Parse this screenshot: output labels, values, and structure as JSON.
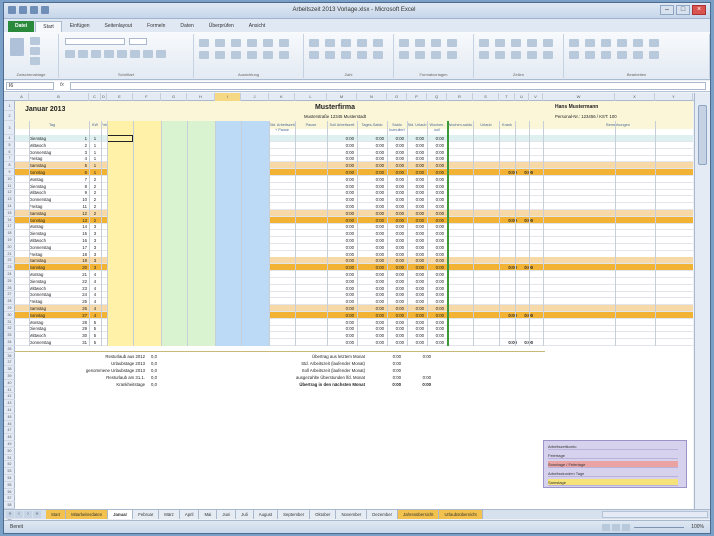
{
  "window": {
    "title": "Arbeitszeit 2013 Vorlage.xlsx - Microsoft Excel"
  },
  "ribbon_tabs": [
    "Datei",
    "Start",
    "Einfügen",
    "Seitenlayout",
    "Formeln",
    "Daten",
    "Überprüfen",
    "Ansicht"
  ],
  "ribbon_groups": [
    "Zwischenablage",
    "Schriftart",
    "Ausrichtung",
    "Zahl",
    "Formatvorlagen",
    "Zellen",
    "Bearbeiten"
  ],
  "formula_bar": {
    "name_box": "I6",
    "fx": "fx",
    "value": ""
  },
  "columns": [
    "A",
    "B",
    "C",
    "D",
    "E",
    "F",
    "G",
    "H",
    "I",
    "J",
    "K",
    "L",
    "M",
    "N",
    "O",
    "P",
    "Q",
    "R",
    "S",
    "T",
    "U",
    "V",
    "W",
    "X",
    "Y",
    "Z"
  ],
  "header": {
    "month": "Januar 2013",
    "company": "Musterfirma",
    "address": "Musterstraße 12345 Musterstadt",
    "employee": "Hans Mustermann",
    "personnel": "Personal-Nr.: 123456 / KST: 100"
  },
  "table_headers": [
    "Tag",
    "KW",
    "Feiertag",
    "Beginn 1",
    "Ende 1",
    "Beginn 2",
    "Ende 2",
    "Beginn 3",
    "Ende 3",
    "Std. Arbeitszeit + Pause",
    "Pause",
    "Soll Arbeitszeit",
    "Tages-Saldo",
    "Saldo kumuliert",
    "Std. Urlaub",
    "Wochen-soll",
    "Wochen-saldo",
    "Urlaub",
    "Krank",
    "Bemerkungen"
  ],
  "days": [
    {
      "n": "1",
      "name": "Dienstag",
      "kw": "1",
      "type": "holiday",
      "note": "Neujahr"
    },
    {
      "n": "2",
      "name": "Mittwoch",
      "kw": "1",
      "type": "normal"
    },
    {
      "n": "3",
      "name": "Donnerstag",
      "kw": "1",
      "type": "normal"
    },
    {
      "n": "4",
      "name": "Freitag",
      "kw": "1",
      "type": "normal"
    },
    {
      "n": "5",
      "name": "Samstag",
      "kw": "1",
      "type": "sat"
    },
    {
      "n": "6",
      "name": "Sonntag",
      "kw": "1",
      "type": "sunholiday",
      "note": "Hl. 3 Könige",
      "wk": true
    },
    {
      "n": "7",
      "name": "Montag",
      "kw": "2",
      "type": "normal"
    },
    {
      "n": "8",
      "name": "Dienstag",
      "kw": "2",
      "type": "normal"
    },
    {
      "n": "9",
      "name": "Mittwoch",
      "kw": "2",
      "type": "normal"
    },
    {
      "n": "10",
      "name": "Donnerstag",
      "kw": "2",
      "type": "normal"
    },
    {
      "n": "11",
      "name": "Freitag",
      "kw": "2",
      "type": "normal"
    },
    {
      "n": "12",
      "name": "Samstag",
      "kw": "2",
      "type": "sat"
    },
    {
      "n": "13",
      "name": "Sonntag",
      "kw": "2",
      "type": "sun",
      "wk": true
    },
    {
      "n": "14",
      "name": "Montag",
      "kw": "3",
      "type": "normal"
    },
    {
      "n": "15",
      "name": "Dienstag",
      "kw": "3",
      "type": "normal"
    },
    {
      "n": "16",
      "name": "Mittwoch",
      "kw": "3",
      "type": "normal"
    },
    {
      "n": "17",
      "name": "Donnerstag",
      "kw": "3",
      "type": "normal"
    },
    {
      "n": "18",
      "name": "Freitag",
      "kw": "3",
      "type": "normal"
    },
    {
      "n": "19",
      "name": "Samstag",
      "kw": "3",
      "type": "sat"
    },
    {
      "n": "20",
      "name": "Sonntag",
      "kw": "3",
      "type": "sun",
      "wk": true
    },
    {
      "n": "21",
      "name": "Montag",
      "kw": "4",
      "type": "normal"
    },
    {
      "n": "22",
      "name": "Dienstag",
      "kw": "4",
      "type": "normal"
    },
    {
      "n": "23",
      "name": "Mittwoch",
      "kw": "4",
      "type": "normal"
    },
    {
      "n": "24",
      "name": "Donnerstag",
      "kw": "4",
      "type": "normal"
    },
    {
      "n": "25",
      "name": "Freitag",
      "kw": "4",
      "type": "normal"
    },
    {
      "n": "26",
      "name": "Samstag",
      "kw": "4",
      "type": "sat"
    },
    {
      "n": "27",
      "name": "Sonntag",
      "kw": "4",
      "type": "sun",
      "wk": true
    },
    {
      "n": "28",
      "name": "Montag",
      "kw": "5",
      "type": "normal"
    },
    {
      "n": "29",
      "name": "Dienstag",
      "kw": "5",
      "type": "normal"
    },
    {
      "n": "30",
      "name": "Mittwoch",
      "kw": "5",
      "type": "normal"
    },
    {
      "n": "31",
      "name": "Donnerstag",
      "kw": "5",
      "type": "normal",
      "wk": true
    }
  ],
  "zero": "0:00",
  "summary_left": [
    {
      "label": "Resturlaub aus 2012",
      "value": "0,0"
    },
    {
      "label": "Urlaubstage 2013",
      "value": "0,0"
    },
    {
      "label": "genommene Urlaubstage 2013",
      "value": "0,0"
    },
    {
      "label": "Resturlaub am 31.1.",
      "value": "0,0"
    },
    {
      "label": "Krankheitstage",
      "value": "0,0"
    }
  ],
  "summary_mid": [
    {
      "label": "Übertrag aus letztem Monat",
      "v1": "0:00",
      "v2": "0:00"
    },
    {
      "label": "Std. Arbeitszeit (laufender Monat)",
      "v1": "0:00",
      "v2": ""
    },
    {
      "label": "Soll Arbeitszeit (laufender Monat)",
      "v1": "0:00",
      "v2": ""
    },
    {
      "label": "ausgezahlte Überstunden lfd. Monat",
      "v1": "0:00",
      "v2": "0:00"
    },
    {
      "label": "Übertrag in den nächsten Monat",
      "v1": "0:00",
      "v2": "0:00"
    }
  ],
  "legend": [
    "Arbeitszeitkonto",
    "Feiertage",
    "Sonntage / Feiertage",
    "Arbeitsstunden Tage",
    "Samstage"
  ],
  "sheet_tabs": [
    "Start",
    "Mitarbeiterdaten",
    "Januar",
    "Februar",
    "März",
    "April",
    "Mai",
    "Juni",
    "Juli",
    "August",
    "September",
    "Oktober",
    "November",
    "Dezember",
    "Jahresübersicht",
    "Urlaubsübersicht"
  ],
  "status": {
    "ready": "Bereit",
    "zoom": "100%"
  },
  "colors": {
    "yellow": "#fff2a8",
    "green": "#d9f2d0",
    "blue": "#bcd9f5",
    "sat": "#f7d9a8",
    "sun": "#f2b233",
    "header": "#fbf6d8",
    "today": "#dff0f0"
  }
}
